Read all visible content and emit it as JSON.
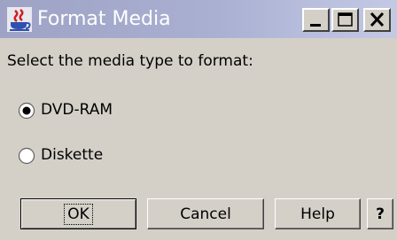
{
  "window": {
    "title": "Format Media",
    "icon": "java-coffee-cup-icon",
    "controls": [
      "minimize-icon",
      "maximize-icon",
      "close-icon"
    ]
  },
  "dialog": {
    "prompt": "Select the media type to format:",
    "options": [
      {
        "label": "DVD-RAM",
        "selected": true
      },
      {
        "label": "Diskette",
        "selected": false
      }
    ]
  },
  "buttons": {
    "ok": "OK",
    "cancel": "Cancel",
    "help": "Help",
    "context_help": "?"
  }
}
